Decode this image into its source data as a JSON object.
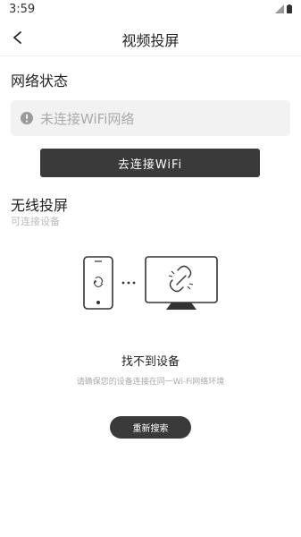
{
  "status_bar": {
    "time": "3:59",
    "icons": [
      "signal-icon",
      "battery-icon"
    ]
  },
  "nav": {
    "back_icon": "chevron-left-icon",
    "title": "视频投屏"
  },
  "network": {
    "section_title": "网络状态",
    "status_icon": "alert-circle-icon",
    "status_text": "未连接WiFi网络",
    "connect_button": "去连接WiFi"
  },
  "wireless": {
    "section_title": "无线投屏",
    "subtitle": "可连接设备",
    "illustration_icons": [
      "phone-icon",
      "ellipsis-icon",
      "tv-icon",
      "broken-link-icon"
    ],
    "empty_title": "找不到设备",
    "empty_hint": "请确保您的设备连接在同一Wi-Fi网络环境",
    "rescan_button": "重新搜索"
  },
  "colors": {
    "primary_button": "#3a3a3a",
    "status_box_bg": "#f2f2f2",
    "muted_text": "#aaaaaa"
  }
}
